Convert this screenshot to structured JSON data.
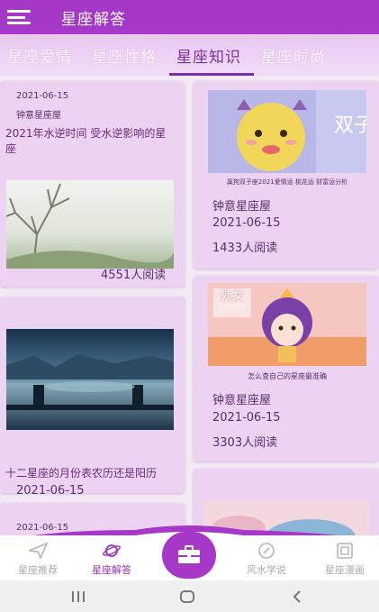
{
  "app": {
    "title": "星座解答"
  },
  "tabs": [
    {
      "label": "星座爱情",
      "active": false
    },
    {
      "label": "星座性格",
      "active": false
    },
    {
      "label": "星座知识",
      "active": true
    },
    {
      "label": "星座时尚",
      "active": false
    }
  ],
  "cards": {
    "left1": {
      "date_top": "2021-06-15",
      "source_top": "钟意星座屋",
      "title": "2021年水逆时间 受水逆影响的星座",
      "views": "4551人阅读"
    },
    "left2": {
      "title": "十二星座的月份表农历还是阳历",
      "date": "2021-06-15"
    },
    "left3": {
      "date": "2021-06-15"
    },
    "right1": {
      "caption": "属狗双子座2021爱情运 桃花运 财富运分析",
      "source": "钟意星座屋",
      "date": "2021-06-15",
      "views": "1433人阅读"
    },
    "right2": {
      "badge": "处女",
      "badge_sub": "8.23-9.22",
      "caption": "怎么查自己的星座最准确",
      "source": "钟意星座屋",
      "date": "2021-06-15",
      "views": "3303人阅读"
    }
  },
  "bottom_nav": [
    {
      "label": "星座推荐",
      "icon": "paper-plane-icon",
      "active": false
    },
    {
      "label": "星座解答",
      "icon": "planet-icon",
      "active": true
    },
    {
      "label": "",
      "icon": "briefcase-icon",
      "active": false
    },
    {
      "label": "风水学说",
      "icon": "compass-icon",
      "active": false
    },
    {
      "label": "星座漫画",
      "icon": "comic-icon",
      "active": false
    }
  ],
  "colors": {
    "primary": "#a638c7",
    "tab_active": "#7a2fa4",
    "card": "#ecd3f1",
    "nav_active": "#9b2fb6"
  }
}
